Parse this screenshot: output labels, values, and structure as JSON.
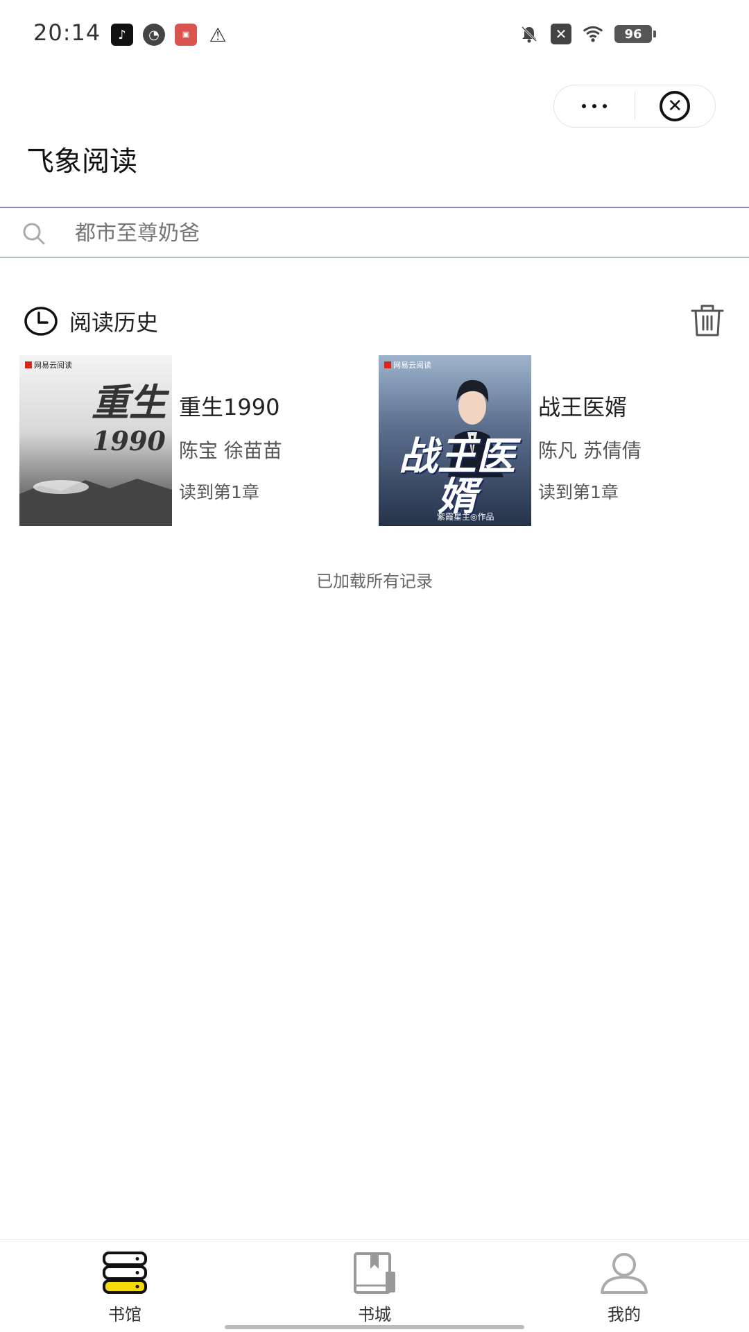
{
  "status_bar": {
    "time": "20:14",
    "battery": "96",
    "left_icons": [
      "tiktok-icon",
      "gauge-icon",
      "app-icon",
      "warning-icon"
    ],
    "right_icons": [
      "mute-bell-icon",
      "x-box-icon",
      "wifi-icon",
      "battery-icon"
    ]
  },
  "app": {
    "title": "飞象阅读"
  },
  "search": {
    "placeholder": "都市至尊奶爸"
  },
  "history": {
    "title": "阅读历史",
    "books": [
      {
        "title": "重生1990",
        "author": "陈宝 徐苗苗",
        "progress": "读到第1章",
        "cover": {
          "publisher": "网易云阅读",
          "text": "重生",
          "year": "1990"
        }
      },
      {
        "title": "战王医婿",
        "author": "陈凡 苏倩倩",
        "progress": "读到第1章",
        "cover": {
          "publisher": "网易云阅读",
          "text": "战王医婿",
          "byline": "紫霞星主◎作品"
        }
      }
    ],
    "end_message": "已加载所有记录"
  },
  "tabs": [
    {
      "label": "书馆",
      "icon": "bookshelf-icon",
      "active": true,
      "color": "#f5d90a"
    },
    {
      "label": "书城",
      "icon": "book-icon",
      "active": false
    },
    {
      "label": "我的",
      "icon": "user-icon",
      "active": false
    }
  ]
}
